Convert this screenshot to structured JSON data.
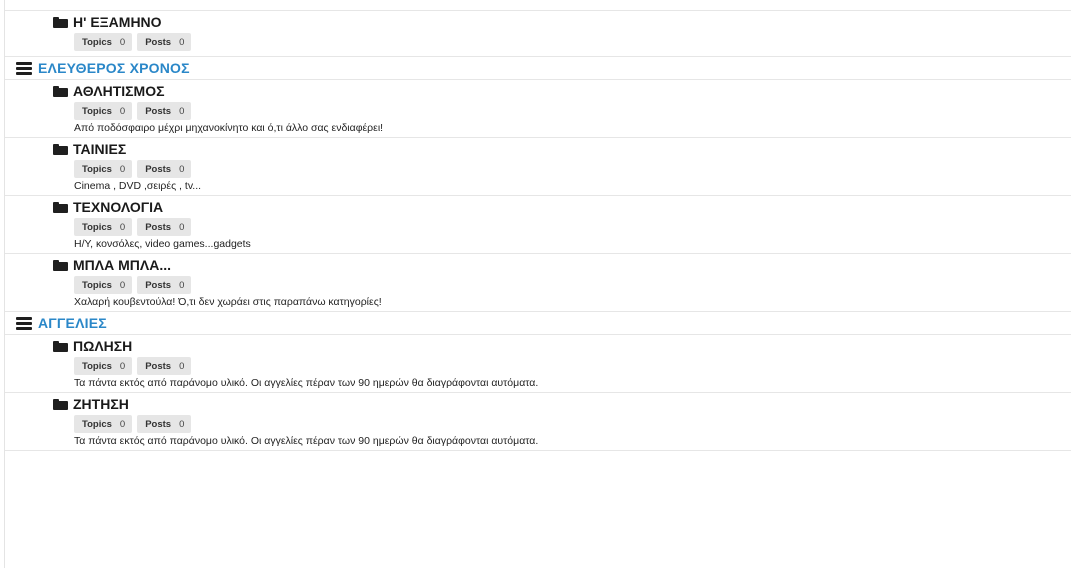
{
  "stat_labels": {
    "topics": "Topics",
    "posts": "Posts"
  },
  "colors": {
    "category_link": "#2a87c8",
    "badge_bg": "#e6e6e6"
  },
  "icons": {
    "category": "hamburger-icon",
    "forum": "folder-icon"
  },
  "orphan_forum": {
    "title": "Η' ΕΞΑΜΗΝΟ",
    "topics": "0",
    "posts": "0"
  },
  "categories": [
    {
      "title": "ΕΛΕΥΘΕΡΟΣ ΧΡΟΝΟΣ",
      "forums": [
        {
          "title": "ΑΘΛΗΤΙΣΜΟΣ",
          "topics": "0",
          "posts": "0",
          "description": "Από ποδόσφαιρο μέχρι μηχανοκίνητο και ό,τι άλλο σας ενδιαφέρει!"
        },
        {
          "title": "ΤΑΙΝΙΕΣ",
          "topics": "0",
          "posts": "0",
          "description": "Cinema , DVD ,σειρές , tv..."
        },
        {
          "title": "ΤΕΧΝΟΛΟΓΙΑ",
          "topics": "0",
          "posts": "0",
          "description": "Η/Υ, κονσόλες, video games...gadgets"
        },
        {
          "title": "ΜΠΛΑ ΜΠΛΑ...",
          "topics": "0",
          "posts": "0",
          "description": "Χαλαρή κουβεντούλα! Ό,τι δεν χωράει στις παραπάνω κατηγορίες!"
        }
      ]
    },
    {
      "title": "ΑΓΓΕΛΙΕΣ",
      "forums": [
        {
          "title": "ΠΩΛΗΣΗ",
          "topics": "0",
          "posts": "0",
          "description": "Τα πάντα εκτός από παράνομο υλικό. Οι αγγελίες πέραν των 90 ημερών θα διαγράφονται αυτόματα."
        },
        {
          "title": "ΖΗΤΗΣΗ",
          "topics": "0",
          "posts": "0",
          "description": "Τα πάντα εκτός από παράνομο υλικό. Οι αγγελίες πέραν των 90 ημερών θα διαγράφονται αυτόματα."
        }
      ]
    }
  ]
}
